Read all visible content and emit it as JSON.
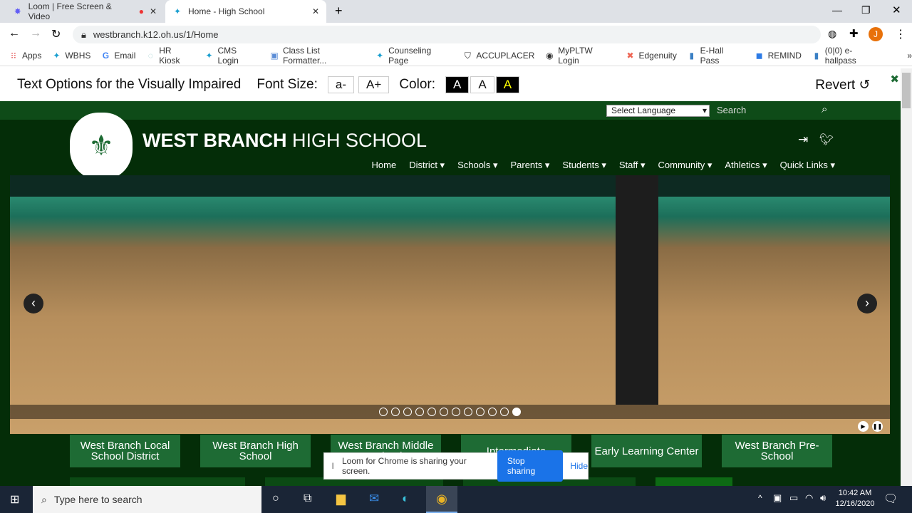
{
  "browser": {
    "tabs": [
      {
        "label": "Loom | Free Screen & Video",
        "icon": "loom-icon",
        "recording": true
      },
      {
        "label": "Home - High School",
        "icon": "school-icon",
        "active": true
      }
    ],
    "url": "westbranch.k12.oh.us/1/Home",
    "profile_initial": "J",
    "bookmarks": [
      "Apps",
      "WBHS",
      "Email",
      "HR Kiosk",
      "CMS Login",
      "Class List Formatter...",
      "Counseling Page",
      "ACCUPLACER",
      "MyPLTW Login",
      "Edgenuity",
      "E-Hall Pass",
      "REMIND",
      "(0|0) e-hallpass"
    ],
    "more": "»"
  },
  "accessibility": {
    "title": "Text Options for the Visually Impaired",
    "font_size_label": "Font Size:",
    "smaller": "a-",
    "larger": "A+",
    "color_label": "Color:",
    "color_options": [
      "A",
      "A",
      "A"
    ],
    "revert": "Revert",
    "close": "✖"
  },
  "site": {
    "language": "Select Language",
    "search_placeholder": "Search",
    "school_bold": "WEST BRANCH",
    "school_light": " HIGH SCHOOL",
    "nav": [
      "Home",
      "District ▾",
      "Schools ▾",
      "Parents ▾",
      "Students ▾",
      "Staff ▾",
      "Community ▾",
      "Athletics ▾",
      "Quick Links ▾"
    ],
    "slides_total": 12,
    "slide_active": 12,
    "quick_buttons": [
      "West Branch Local School District",
      "West Branch High School",
      "West Branch Middle School",
      "Intermediate",
      "Early Learning Center",
      "West Branch Pre-School"
    ],
    "colors": {
      "dark_green": "#042d08",
      "button_green": "#1e6b34"
    }
  },
  "loom": {
    "message": "Loom for Chrome is sharing your screen.",
    "stop": "Stop sharing",
    "hide": "Hide"
  },
  "taskbar": {
    "search_placeholder": "Type here to search",
    "time": "10:42 AM",
    "date": "12/16/2020"
  }
}
